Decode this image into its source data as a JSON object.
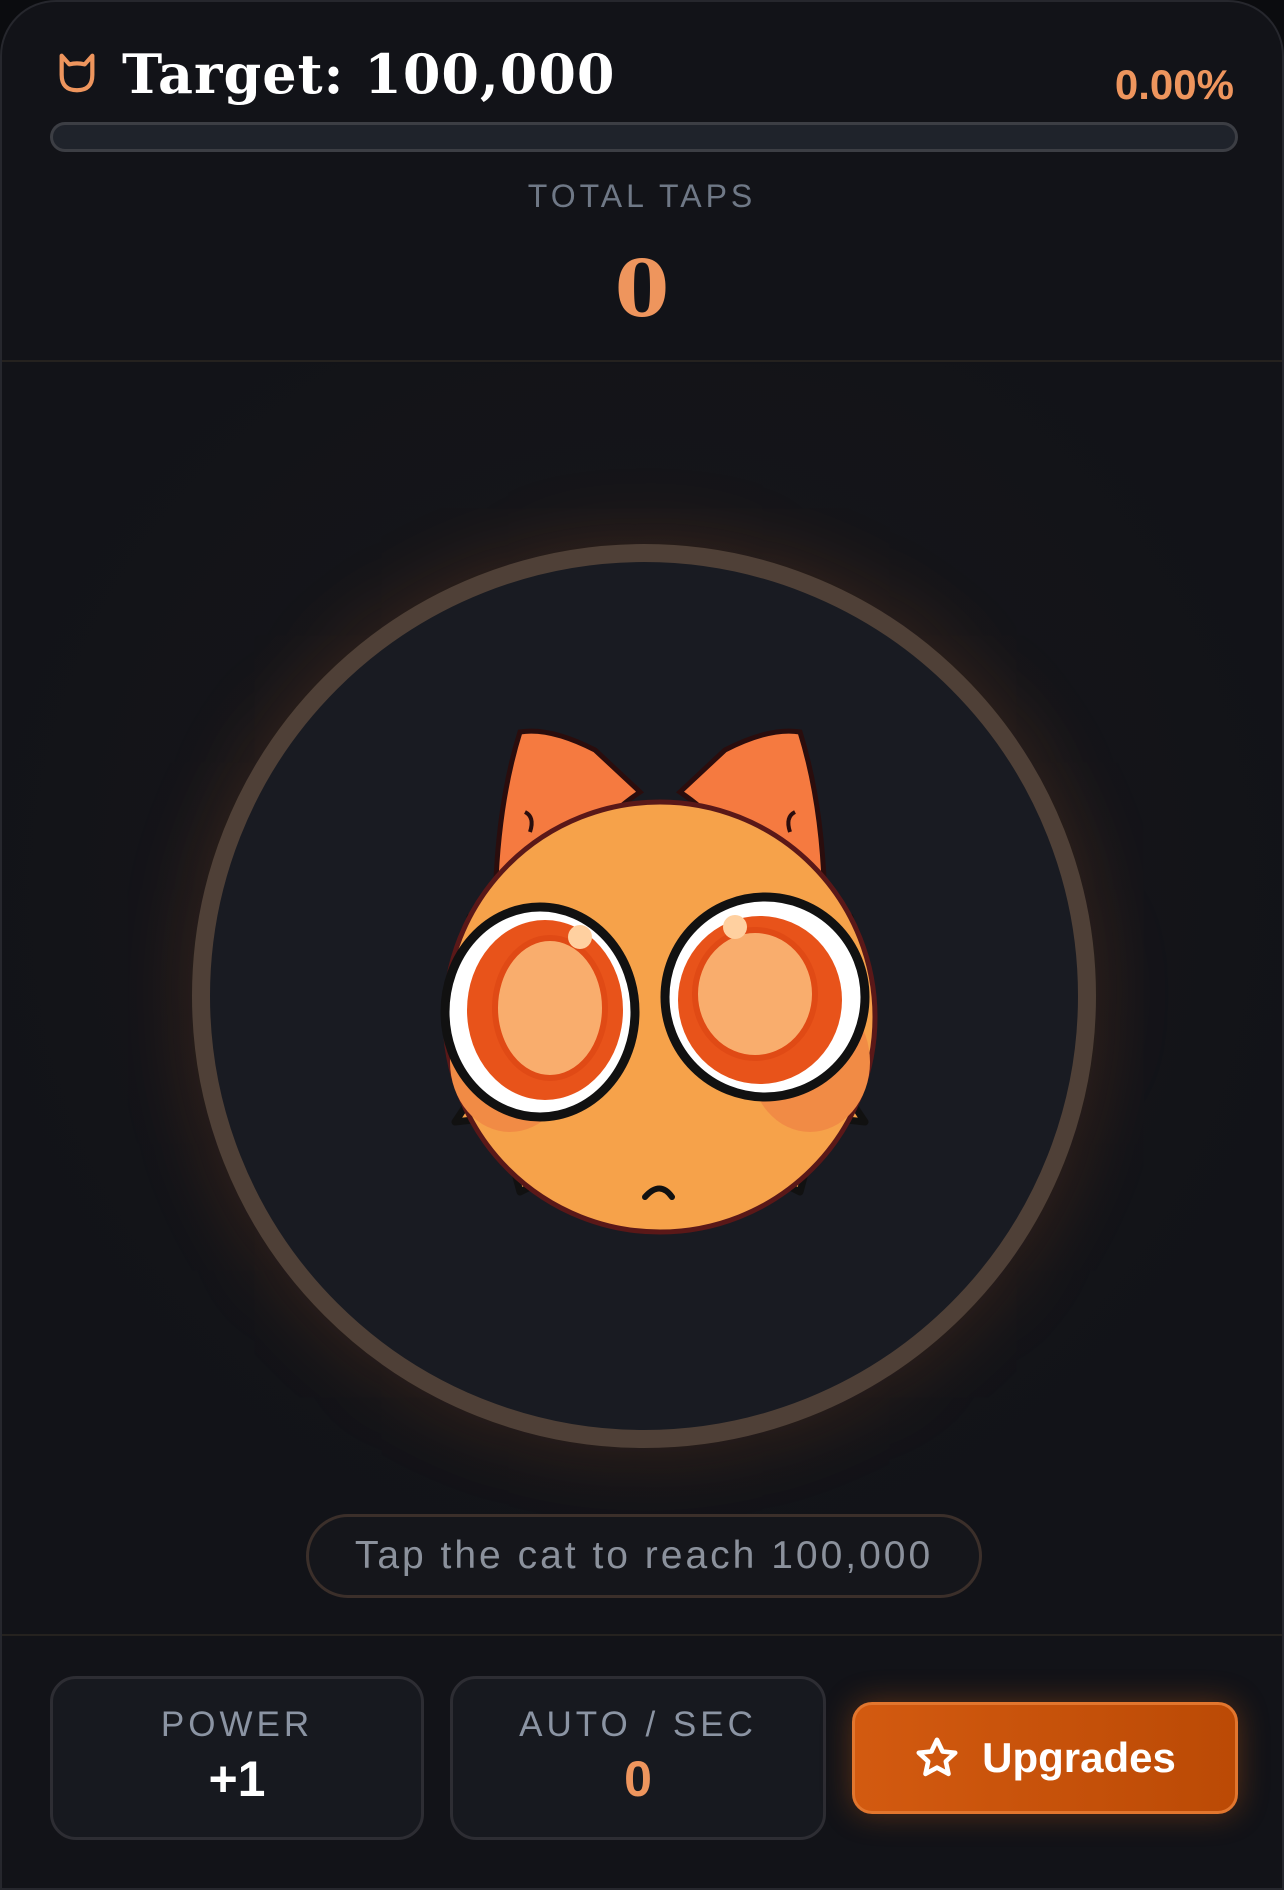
{
  "header": {
    "title": "Target: 100,000",
    "percent": "0.00%",
    "progress": 0.0,
    "icon": "cat-head-icon"
  },
  "taps": {
    "label": "TOTAL TAPS",
    "value": "0"
  },
  "stage": {
    "hint": "Tap the cat to reach 100,000"
  },
  "footer": {
    "power": {
      "label": "POWER",
      "value": "+1"
    },
    "auto": {
      "label": "AUTO / SEC",
      "value": "0"
    },
    "upgrades": {
      "label": "Upgrades",
      "icon": "star-icon"
    }
  },
  "colors": {
    "accent": "#ee955d",
    "button": "#c9530a",
    "background": "#121318"
  }
}
